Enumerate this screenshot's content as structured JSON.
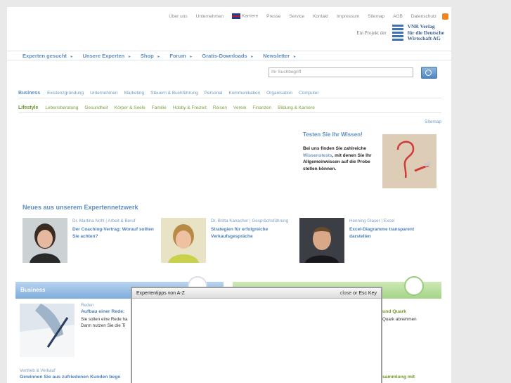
{
  "topnav": {
    "items": [
      "Über uns",
      "Unternehmen",
      "Karriere",
      "Presse",
      "Service",
      "Kontakt",
      "Impressum",
      "Sitemap",
      "AGB",
      "Datenschutz"
    ]
  },
  "vnr": {
    "project_label": "Ein Projekt der",
    "line1": "VNR Verlag",
    "line2": "für die Deutsche",
    "line3": "Wirtschaft AG"
  },
  "mainnav": {
    "items": [
      "Experten gesucht",
      "Unsere Experten",
      "Shop",
      "Forum",
      "Gratis-Downloads",
      "Newsletter"
    ]
  },
  "search": {
    "placeholder": "Ihr Suchbegriff"
  },
  "business": {
    "label": "Business",
    "cats": [
      "Existenzgründung",
      "Unternehmen",
      "Marketing",
      "Steuern & Buchführung",
      "Personal",
      "Kommunikation",
      "Organisation",
      "Computer"
    ]
  },
  "lifestyle": {
    "label": "Lifestyle",
    "cats": [
      "Lebensberatung",
      "Gesundheit",
      "Körper & Seele",
      "Familie",
      "Hobby & Freizeit",
      "Reisen",
      "Verein",
      "Finanzen",
      "Bildung & Karriere"
    ]
  },
  "sitemap_link": "Sitemap",
  "test": {
    "title": "Testen Sie Ihr Wissen!",
    "text_before": "Bei uns finden Sie zahlreiche ",
    "highlight": "Wissenstests",
    "text_after": ", mit denen Sie Ihr Allgemeinwissen auf die Probe stellen können."
  },
  "news": {
    "title": "Neues aus unserem Expertennetzwerk",
    "items": [
      {
        "author": "Dr. Martina Nohl",
        "category": "Arbeit & Beruf",
        "headline": "Der Coaching-Vertrag: Worauf sollten Sie achten?"
      },
      {
        "author": "Dr. Britta Kanacher",
        "category": "Gesprächsführung",
        "headline": "Strategien für erfolgreiche Verkaufsgespräche"
      },
      {
        "author": "Henning Glaser",
        "category": "Excel",
        "headline": "Excel-Diagramme transparent darstellen"
      }
    ]
  },
  "biz_box": {
    "title": "Business",
    "article_category": "Reden",
    "article_headline": "Aufbau einer Rede:",
    "article_text_1": "Sie sollen eine Rede ha",
    "article_text_2": "Dann nutzen Sie die Ti",
    "vv_category": "Vertrieb & Verkauf",
    "vv_headline": "Gewinnen Sie aus zufriedenen Kunden bege"
  },
  "right_frags": {
    "f1": "und Quark",
    "f2": "Quark abnehmen",
    "f3": "sammlung mit"
  },
  "modal": {
    "title": "Expertentipps von A-Z",
    "close_label": "close",
    "close_or": "or",
    "close_key": "Esc Key"
  }
}
